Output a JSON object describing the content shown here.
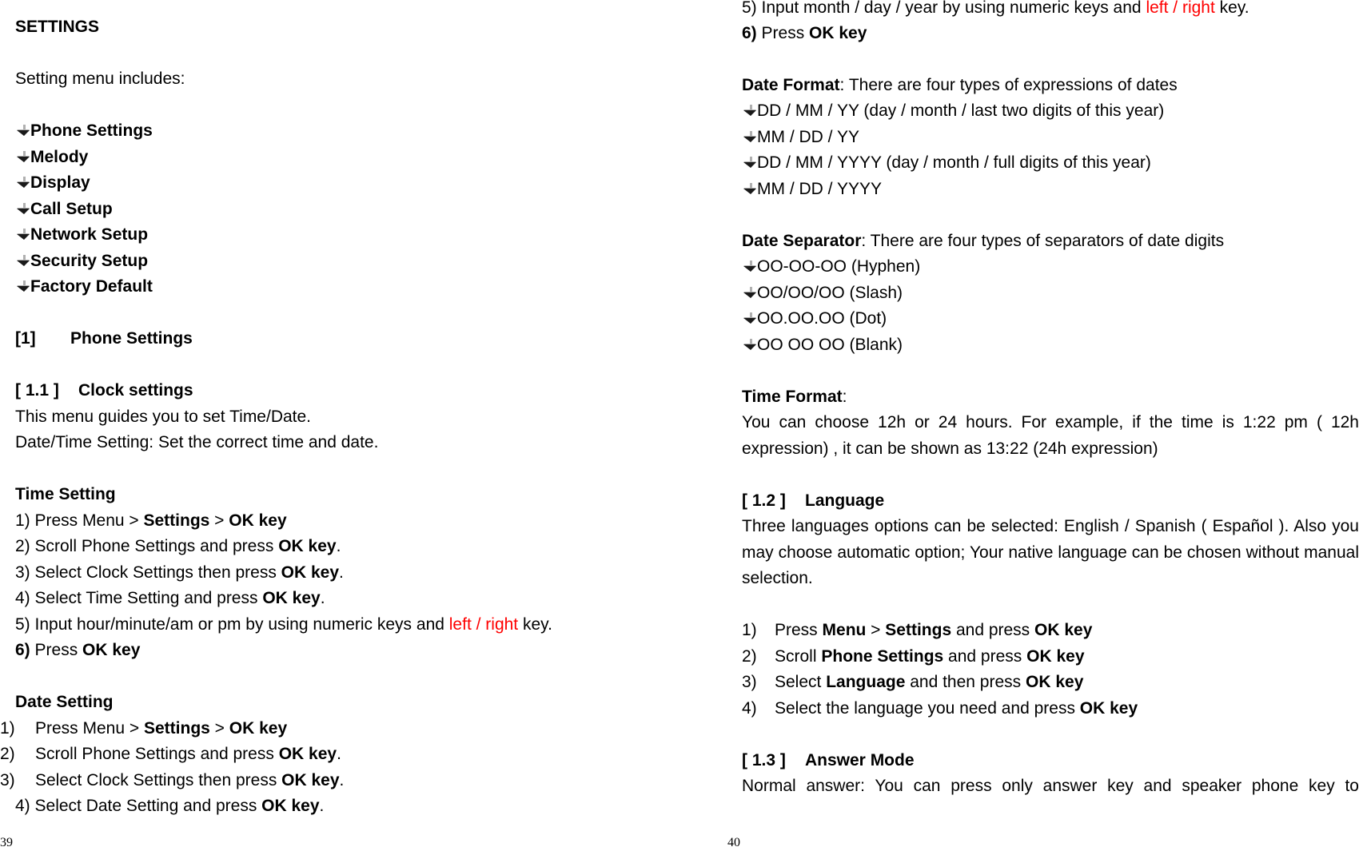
{
  "left_page": {
    "title": "SETTINGS",
    "intro": "Setting menu includes:",
    "menu_items": [
      "Phone Settings",
      "Melody",
      "Display",
      "Call Setup",
      "Network Setup",
      "Security Setup",
      "Factory Default"
    ],
    "section1": {
      "number": "[1]",
      "title": "Phone Settings"
    },
    "section1_1": {
      "number": "[ 1.1 ]",
      "title": "Clock settings"
    },
    "clock_desc_1": "This menu guides you to set Time/Date.",
    "clock_desc_2": "Date/Time Setting: Set the correct time and date.",
    "time_setting": {
      "heading": "Time Setting",
      "steps": [
        {
          "pre": "1) Press Menu > ",
          "b1": "Settings",
          "mid": " > ",
          "b2": "OK key",
          "post": ""
        },
        {
          "pre": "2) Scroll Phone Settings and press ",
          "b1": "OK key",
          "post": "."
        },
        {
          "pre": "3) Select Clock Settings then press ",
          "b1": "OK key",
          "post": "."
        },
        {
          "pre": "4) Select Time Setting and press ",
          "b1": "OK key",
          "post": "."
        },
        {
          "pre": "5) Input hour/minute/am or pm by using numeric keys and ",
          "red": "left / right",
          "post": " key."
        },
        {
          "bnum": "6)",
          "pre": " Press ",
          "b1": "OK key"
        }
      ]
    },
    "date_setting": {
      "heading": "Date Setting",
      "steps": [
        {
          "num": "1)",
          "pre": "Press Menu > ",
          "b1": "Settings",
          "mid": " > ",
          "b2": "OK key"
        },
        {
          "num": "2)",
          "pre": "Scroll Phone Settings and press ",
          "b1": "OK key",
          "post": "."
        },
        {
          "num": "3)",
          "pre": "Select Clock Settings then press ",
          "b1": "OK key",
          "post": "."
        },
        {
          "pre": "4) Select Date Setting and press ",
          "b1": "OK key",
          "post": "."
        }
      ]
    },
    "page_number": "39"
  },
  "right_page": {
    "step5": {
      "pre": "5) Input month / day / year by using numeric keys and ",
      "red": "left / right",
      "post": " key."
    },
    "step6": {
      "bnum": "6)",
      "pre": " Press ",
      "b1": "OK key"
    },
    "date_format": {
      "label": "Date Format",
      "desc": ": There are four types of expressions of dates",
      "options": [
        "DD / MM / YY (day / month / last two digits of this year)",
        "MM / DD / YY",
        "DD / MM / YYYY (day / month / full digits of this year)",
        "MM / DD / YYYY"
      ]
    },
    "date_separator": {
      "label": "Date Separator",
      "desc": ": There are four types of separators of date digits",
      "options": [
        "OO-OO-OO (Hyphen)",
        "OO/OO/OO (Slash)",
        "OO.OO.OO (Dot)",
        "OO OO OO (Blank)"
      ]
    },
    "time_format": {
      "label": "Time Format",
      "colon": ":",
      "desc": "You can choose 12h or 24 hours. For example, if the time is 1:22 pm ( 12h expression) , it can be shown as 13:22 (24h expression)"
    },
    "section1_2": {
      "number": "[ 1.2 ]",
      "title": "Language",
      "desc": "Three languages options can be selected: English / Spanish ( Español ). Also you may choose automatic option; Your native language can be chosen without manual selection.",
      "steps": [
        {
          "num": "1)",
          "pre": "Press ",
          "b1": "Menu",
          "mid": " > ",
          "b2": "Settings",
          "mid2": " and press ",
          "b3": "OK key"
        },
        {
          "num": "2)",
          "pre": "Scroll ",
          "b1": "Phone Settings",
          "mid": " and press ",
          "b2": "OK key"
        },
        {
          "num": "3)",
          "pre": "Select ",
          "b1": "Language",
          "mid": " and then press ",
          "b2": "OK key"
        },
        {
          "num": "4)",
          "pre": "Select the language you need and press ",
          "b1": "OK key"
        }
      ]
    },
    "section1_3": {
      "number": "[ 1.3 ]",
      "title": "Answer Mode",
      "desc": "Normal answer: You can press only answer key and speaker phone key to"
    },
    "page_number": "40"
  }
}
